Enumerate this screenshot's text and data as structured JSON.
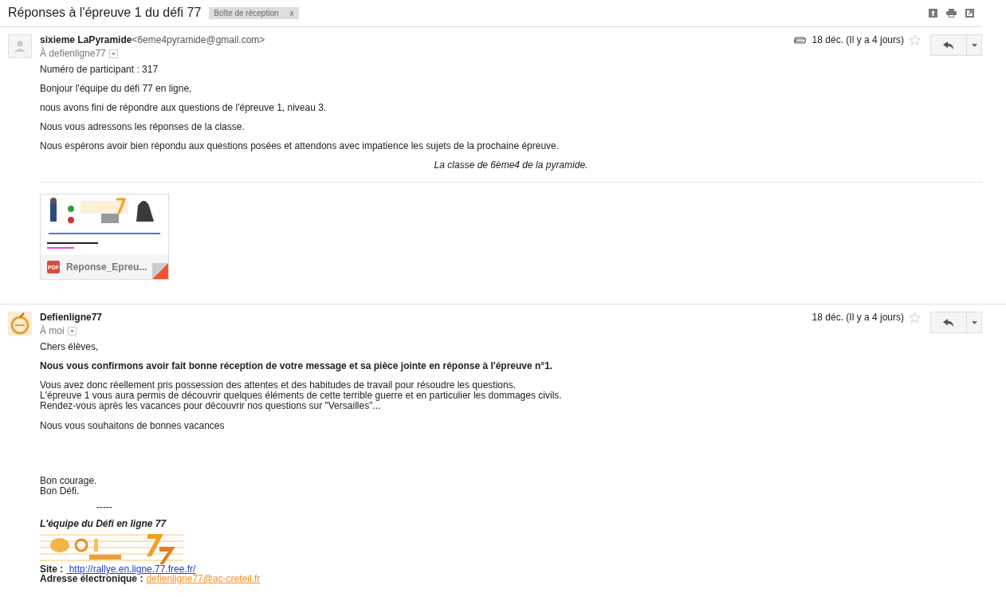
{
  "subject": "Réponses à l'épreuve 1 du défi 77",
  "label": {
    "text": "Boîte de réception",
    "close": "x"
  },
  "messages": [
    {
      "kind": "blank",
      "sender": "sixieme LaPyramide",
      "email": "<6eme4pyramide@gmail.com>",
      "to": "À defienligne77",
      "date": "18 déc. (Il y a 4 jours)",
      "has_attachment": true,
      "starred": false,
      "body": [
        {
          "kind": "p",
          "text": "Numéro de participant : 317"
        },
        {
          "kind": "p",
          "text": "Bonjour l'équipe du défi 77 en ligne,"
        },
        {
          "kind": "p",
          "text": "nous avons fini de répondre aux questions de l'épreuve 1, niveau 3."
        },
        {
          "kind": "p",
          "text": "Nous vous adressons les réponses de la classe."
        },
        {
          "kind": "p",
          "text": "Nous espérons avoir bien répondu aux questions posées et attendons avec impatience les sujets de la prochaine épreuve."
        },
        {
          "kind": "centered",
          "text": "La classe de 6ème4 de la pyramide."
        }
      ],
      "attachment": {
        "name": "Reponse_Epreu...",
        "type": "PDF"
      }
    },
    {
      "kind": "logo",
      "sender": "Defienligne77",
      "to": "À moi",
      "date": "18 déc. (Il y a 4 jours)",
      "has_attachment": false,
      "starred": false,
      "body": [
        {
          "kind": "p",
          "text": "Chers élèves,"
        },
        {
          "kind": "bold",
          "text": "Nous vous confirmons avoir fait bonne réception de votre message et sa pièce jointe en réponse à l'épreuve n°1."
        },
        {
          "kind": "lines",
          "lines": [
            "Vous avez donc réellement pris possession des attentes et des habitudes de travail pour résoudre les questions.",
            "L'épreuve 1 vous aura permis de découvrir quelques éléments de cette terrible guerre et en particulier les dommages civils.",
            "Rendez-vous après les vacances pour découvrir nos questions sur \"Versailles\"..."
          ]
        },
        {
          "kind": "p",
          "text": "Nous vous souhaitons de bonnes vacances"
        },
        {
          "kind": "closing",
          "lines": [
            "Bon courage.",
            "Bon Défi."
          ]
        },
        {
          "kind": "dash",
          "text": "-----"
        },
        {
          "kind": "team",
          "text": "L'équipe du Défi en ligne 77"
        },
        {
          "kind": "logo"
        },
        {
          "kind": "link",
          "label": "Site :",
          "link": " http://rallye.en.ligne.77.free.fr/",
          "color": "#1a3fd6"
        },
        {
          "kind": "link",
          "label": "Adresse électronique :",
          "link": "defienligne77@ac-creteil.fr",
          "color": "#ff8c1a"
        }
      ]
    }
  ]
}
